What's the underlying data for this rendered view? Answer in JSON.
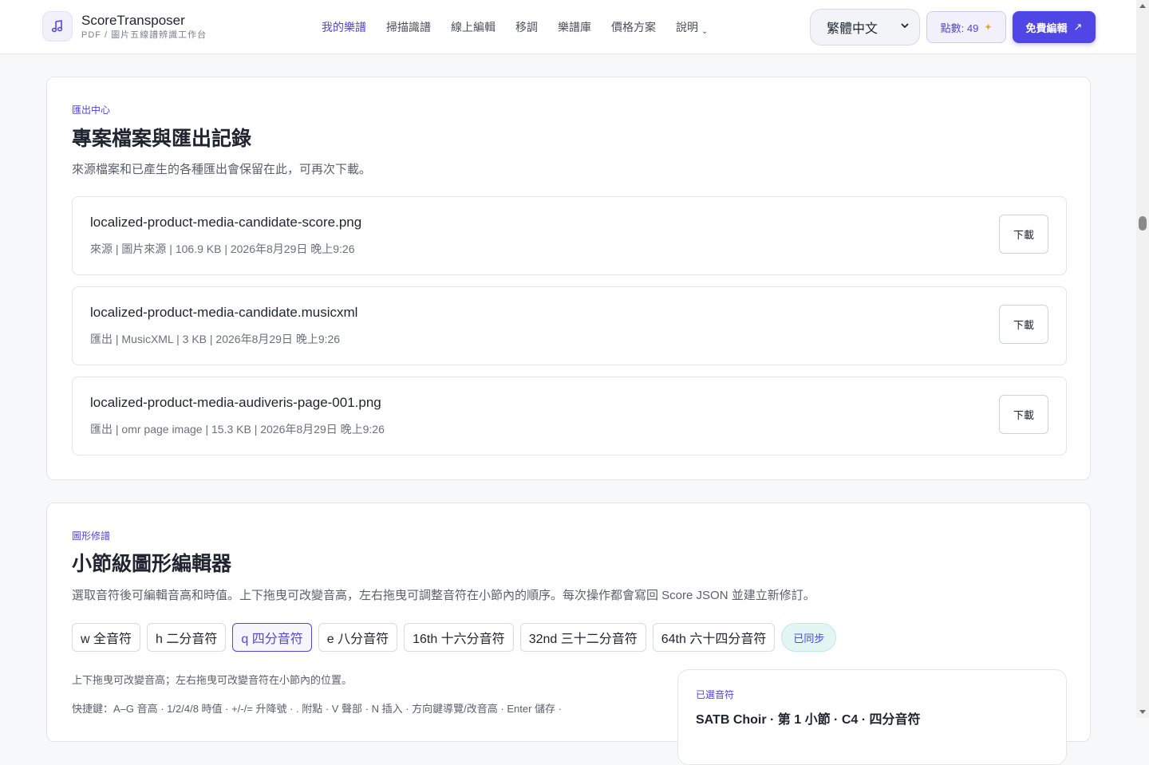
{
  "header": {
    "brand_name": "ScoreTransposer",
    "brand_subtitle": "PDF / 圖片五線譜辨識工作台",
    "nav": [
      {
        "label": "我的樂譜",
        "active": true
      },
      {
        "label": "掃描識譜"
      },
      {
        "label": "線上編輯"
      },
      {
        "label": "移調"
      },
      {
        "label": "樂譜庫"
      },
      {
        "label": "價格方案"
      },
      {
        "label": "說明",
        "has_dropdown": true
      }
    ],
    "language": "繁體中文",
    "credits_label": "點數: 49",
    "cta_label": "免費編輯",
    "cta_icon": "external-arrow-icon"
  },
  "export_center": {
    "eyebrow": "匯出中心",
    "title": "專案檔案與匯出記錄",
    "description": "來源檔案和已產生的各種匯出會保留在此，可再次下載。",
    "download_label": "下載",
    "files": [
      {
        "name": "localized-product-media-candidate-score.png",
        "meta": "來源 | 圖片來源 | 106.9 KB | 2026年8月29日 晚上9:26"
      },
      {
        "name": "localized-product-media-candidate.musicxml",
        "meta": "匯出 | MusicXML | 3 KB | 2026年8月29日 晚上9:26"
      },
      {
        "name": "localized-product-media-audiveris-page-001.png",
        "meta": "匯出 | omr page image | 15.3 KB | 2026年8月29日 晚上9:26"
      }
    ]
  },
  "graphic_editor": {
    "eyebrow": "圖形修譜",
    "title": "小節級圖形編輯器",
    "description": "選取音符後可編輯音高和時值。上下拖曳可改變音高，左右拖曳可調整音符在小節內的順序。每次操作都會寫回 Score JSON 並建立新修訂。",
    "durations": [
      {
        "label": "w 全音符"
      },
      {
        "label": "h 二分音符"
      },
      {
        "label": "q 四分音符",
        "active": true
      },
      {
        "label": "e 八分音符"
      },
      {
        "label": "16th 十六分音符"
      },
      {
        "label": "32nd 三十二分音符"
      },
      {
        "label": "64th 六十四分音符"
      }
    ],
    "sync_status": "已同步",
    "hint_drag": "上下拖曳可改變音高；左右拖曳可改變音符在小節內的位置。",
    "hint_shortcuts": "快捷鍵：A–G 音高 · 1/2/4/8 時值 · +/-/= 升降號 · . 附點 · V 聲部 · N 插入 · 方向鍵導覽/改音高 · Enter 儲存 ·",
    "selected_label": "已選音符",
    "selected_value": "SATB Choir · 第 1 小節 · C4 · 四分音符"
  },
  "colors": {
    "accent": "#4f46e5",
    "sync_bg": "#e3f6f4",
    "spark": "#e2a72a"
  }
}
